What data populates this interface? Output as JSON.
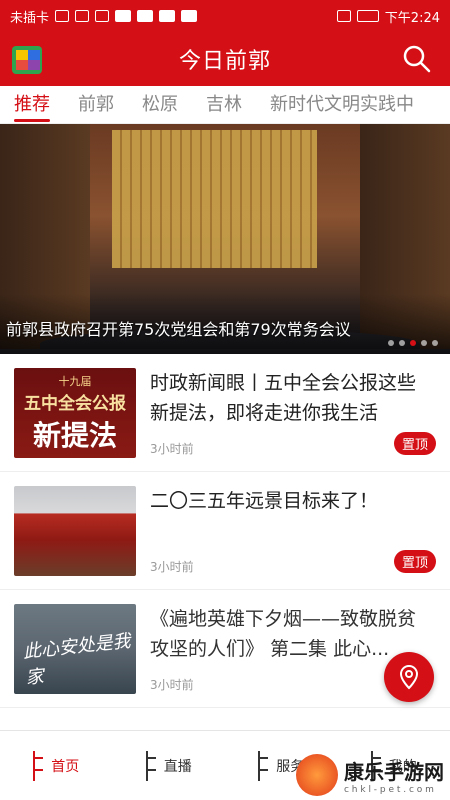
{
  "status_bar": {
    "carrier": "未插卡",
    "time": "下午2:24"
  },
  "app_bar": {
    "title": "今日前郭"
  },
  "tabs": [
    {
      "label": "推荐",
      "active": true
    },
    {
      "label": "前郭",
      "active": false
    },
    {
      "label": "松原",
      "active": false
    },
    {
      "label": "吉林",
      "active": false
    },
    {
      "label": "新时代文明实践中",
      "active": false
    }
  ],
  "hero": {
    "caption": "前郭县政府召开第75次党组会和第79次常务会议",
    "dots_total": 5,
    "dots_active": 3
  },
  "news": [
    {
      "headline": "时政新闻眼丨五中全会公报这些新提法，即将走进你我生活",
      "time": "3小时前",
      "pin": "置顶",
      "thumb_text": {
        "small": "十九届",
        "mid": "五中全会公报",
        "big": "新提法"
      }
    },
    {
      "headline": "二〇三五年远景目标来了！",
      "time": "3小时前",
      "pin": "置顶"
    },
    {
      "headline": "《遍地英雄下夕烟——致敬脱贫攻坚的人们》 第二集 此心...",
      "time": "3小时前",
      "thumb_text": {
        "calli": "此心安处是我家"
      }
    }
  ],
  "bottom_nav": [
    {
      "label": "首页",
      "active": true
    },
    {
      "label": "直播",
      "active": false
    },
    {
      "label": "服务",
      "active": false
    },
    {
      "label": "我的",
      "active": false
    }
  ],
  "watermark": {
    "title": "康乐手游网",
    "sub": "c h k l - p e t . c o m"
  },
  "colors": {
    "brand_red": "#d40f15"
  }
}
